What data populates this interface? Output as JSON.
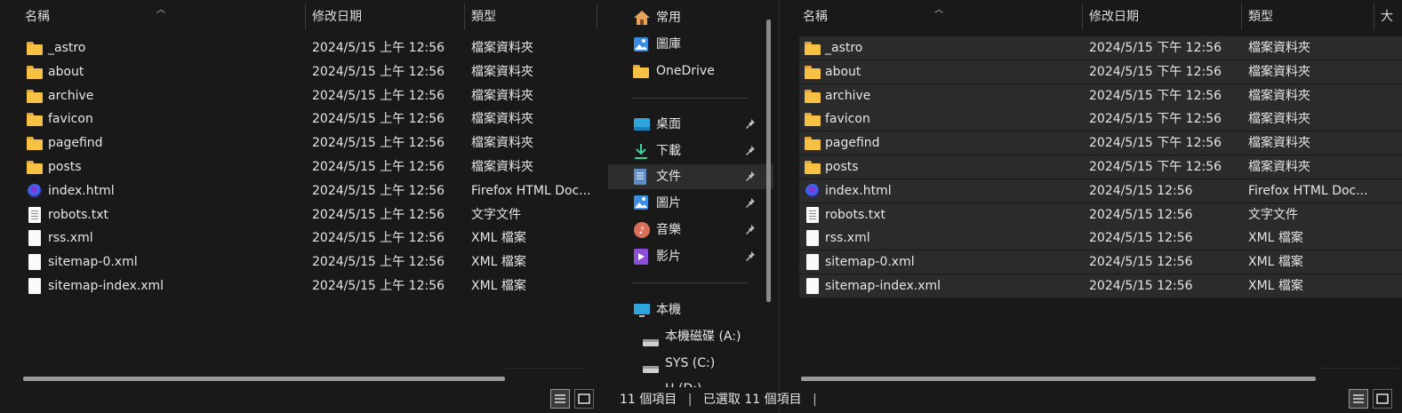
{
  "columns": {
    "name": "名稱",
    "modified": "修改日期",
    "type": "類型",
    "size_partial": "大"
  },
  "left_files": [
    {
      "name": "_astro",
      "date": "2024/5/15 上午 12:56",
      "type": "檔案資料夾",
      "icon": "folder-icon"
    },
    {
      "name": "about",
      "date": "2024/5/15 上午 12:56",
      "type": "檔案資料夾",
      "icon": "folder-icon"
    },
    {
      "name": "archive",
      "date": "2024/5/15 上午 12:56",
      "type": "檔案資料夾",
      "icon": "folder-icon"
    },
    {
      "name": "favicon",
      "date": "2024/5/15 上午 12:56",
      "type": "檔案資料夾",
      "icon": "folder-icon"
    },
    {
      "name": "pagefind",
      "date": "2024/5/15 上午 12:56",
      "type": "檔案資料夾",
      "icon": "folder-icon"
    },
    {
      "name": "posts",
      "date": "2024/5/15 上午 12:56",
      "type": "檔案資料夾",
      "icon": "folder-icon"
    },
    {
      "name": "index.html",
      "date": "2024/5/15 上午 12:56",
      "type": "Firefox HTML Doc...",
      "icon": "firefox-html-icon"
    },
    {
      "name": "robots.txt",
      "date": "2024/5/15 上午 12:56",
      "type": "文字文件",
      "icon": "text-file-icon"
    },
    {
      "name": "rss.xml",
      "date": "2024/5/15 上午 12:56",
      "type": "XML 檔案",
      "icon": "file-icon"
    },
    {
      "name": "sitemap-0.xml",
      "date": "2024/5/15 上午 12:56",
      "type": "XML 檔案",
      "icon": "file-icon"
    },
    {
      "name": "sitemap-index.xml",
      "date": "2024/5/15 上午 12:56",
      "type": "XML 檔案",
      "icon": "file-icon"
    }
  ],
  "right_files": [
    {
      "name": "_astro",
      "date": "2024/5/15 下午 12:56",
      "type": "檔案資料夾",
      "icon": "folder-icon"
    },
    {
      "name": "about",
      "date": "2024/5/15 下午 12:56",
      "type": "檔案資料夾",
      "icon": "folder-icon"
    },
    {
      "name": "archive",
      "date": "2024/5/15 下午 12:56",
      "type": "檔案資料夾",
      "icon": "folder-icon"
    },
    {
      "name": "favicon",
      "date": "2024/5/15 下午 12:56",
      "type": "檔案資料夾",
      "icon": "folder-icon"
    },
    {
      "name": "pagefind",
      "date": "2024/5/15 下午 12:56",
      "type": "檔案資料夾",
      "icon": "folder-icon"
    },
    {
      "name": "posts",
      "date": "2024/5/15 下午 12:56",
      "type": "檔案資料夾",
      "icon": "folder-icon"
    },
    {
      "name": "index.html",
      "date": "2024/5/15 12:56",
      "type": "Firefox HTML Doc...",
      "icon": "firefox-html-icon"
    },
    {
      "name": "robots.txt",
      "date": "2024/5/15 12:56",
      "type": "文字文件",
      "icon": "text-file-icon"
    },
    {
      "name": "rss.xml",
      "date": "2024/5/15 12:56",
      "type": "XML 檔案",
      "icon": "file-icon"
    },
    {
      "name": "sitemap-0.xml",
      "date": "2024/5/15 12:56",
      "type": "XML 檔案",
      "icon": "file-icon"
    },
    {
      "name": "sitemap-index.xml",
      "date": "2024/5/15 12:56",
      "type": "XML 檔案",
      "icon": "file-icon"
    }
  ],
  "nav": {
    "home": "常用",
    "gallery": "圖庫",
    "onedrive": "OneDrive",
    "pinned": [
      {
        "label": "桌面",
        "icon": "desktop-icon"
      },
      {
        "label": "下載",
        "icon": "download-icon"
      },
      {
        "label": "文件",
        "icon": "documents-icon"
      },
      {
        "label": "圖片",
        "icon": "pictures-icon"
      },
      {
        "label": "音樂",
        "icon": "music-icon"
      },
      {
        "label": "影片",
        "icon": "videos-icon"
      }
    ],
    "this_pc": "本機",
    "drives": [
      {
        "label": "本機磁碟 (A:)",
        "icon": "drive-icon"
      },
      {
        "label": "SYS (C:)",
        "icon": "drive-icon"
      },
      {
        "label": "H (D:)",
        "icon": "drive-icon"
      }
    ]
  },
  "status": {
    "count": "11 個項目",
    "selected": "已選取 11 個項目"
  },
  "colors": {
    "folder": "#f7c244",
    "background": "#191919",
    "selection": "#2b2b2b"
  }
}
